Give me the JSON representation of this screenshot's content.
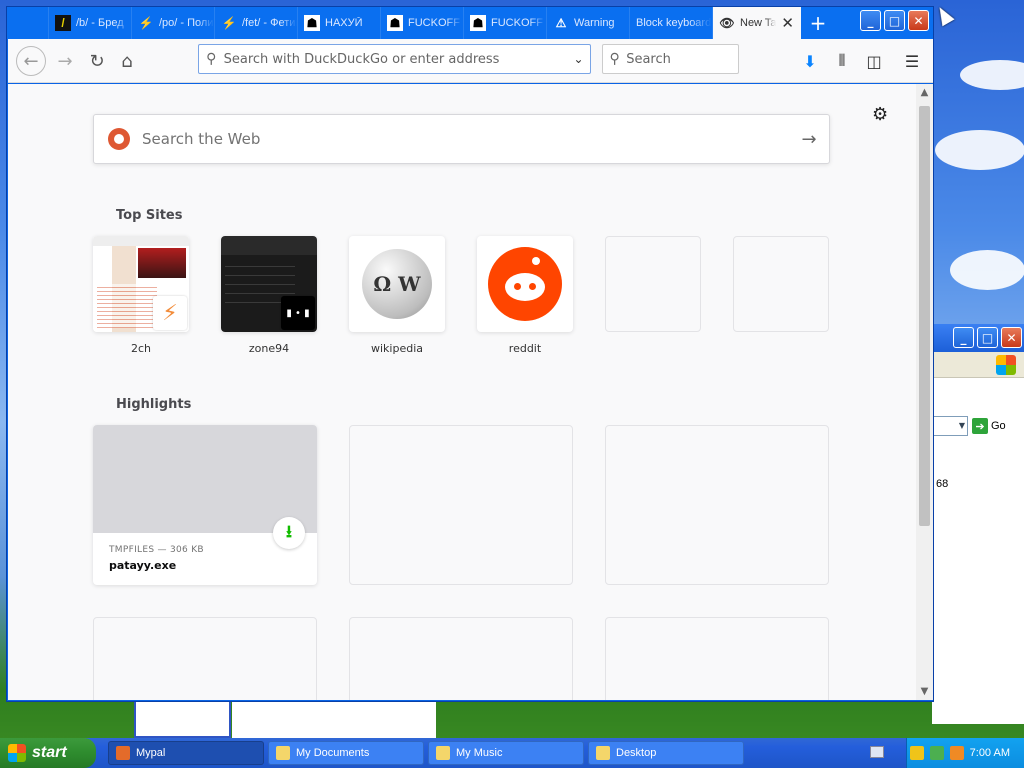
{
  "tabs": [
    {
      "icon": "slash-icon",
      "label": "/b/ - Бред"
    },
    {
      "icon": "bolt-icon",
      "label": "/po/ - Политика"
    },
    {
      "icon": "bolt-icon",
      "label": "/fet/ - Фетиш"
    },
    {
      "icon": "man-icon",
      "label": "НАХУЙ"
    },
    {
      "icon": "man-icon",
      "label": "FUCKOFF"
    },
    {
      "icon": "man-icon",
      "label": "FUCKOFF"
    },
    {
      "icon": "warning-icon",
      "label": "Warning"
    },
    {
      "icon": "",
      "label": "Block keyboard"
    },
    {
      "icon": "eye-icon",
      "label": "New Tab"
    }
  ],
  "address": {
    "placeholder": "Search with DuckDuckGo or enter address"
  },
  "search": {
    "placeholder": "Search"
  },
  "web_search": {
    "placeholder": "Search the Web"
  },
  "top_sites": {
    "title": "Top Sites",
    "sites": [
      {
        "name": "2ch"
      },
      {
        "name": "zone94"
      },
      {
        "name": "wikipedia"
      },
      {
        "name": "reddit"
      },
      {
        "name": ""
      },
      {
        "name": ""
      }
    ]
  },
  "highlights": {
    "title": "Highlights",
    "items": [
      {
        "meta": "TMPFILES — 306 KB",
        "filename": "patayy.exe"
      }
    ]
  },
  "bg_window": {
    "go_label": "Go",
    "number": "68"
  },
  "taskbar": {
    "start": "start",
    "tasks": [
      "Mypal",
      "My Documents",
      "My Music",
      "Desktop"
    ],
    "clock": "7:00 AM"
  }
}
